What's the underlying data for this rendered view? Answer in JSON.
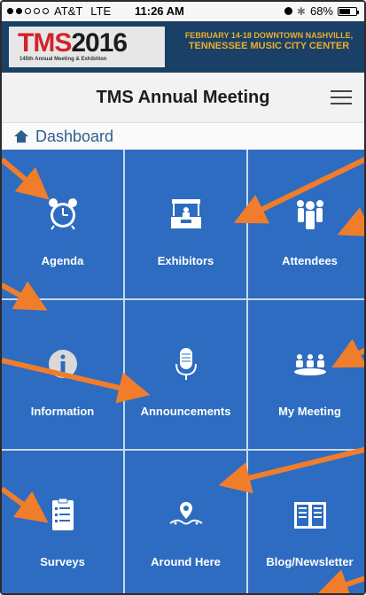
{
  "status_bar": {
    "carrier": "AT&T",
    "network": "LTE",
    "time": "11:26 AM",
    "battery": "68%",
    "battery_level": 0.68
  },
  "banner": {
    "logo_tms": "TMS",
    "logo_year": "2016",
    "logo_subtitle": "145th Annual Meeting & Exhibition",
    "dates_line": "FEBRUARY 14-18 DOWNTOWN NASHVILLE,",
    "venue_line": "TENNESSEE MUSIC CITY CENTER"
  },
  "header": {
    "title": "TMS Annual Meeting",
    "menu_icon": "hamburger-icon"
  },
  "breadcrumb": {
    "icon": "home-icon",
    "label": "Dashboard"
  },
  "tiles": [
    {
      "label": "Agenda",
      "icon": "alarm-clock-icon"
    },
    {
      "label": "Exhibitors",
      "icon": "booth-icon"
    },
    {
      "label": "Attendees",
      "icon": "people-icon"
    },
    {
      "label": "Information",
      "icon": "info-icon"
    },
    {
      "label": "Announcements",
      "icon": "microphone-icon"
    },
    {
      "label": "My Meeting",
      "icon": "meeting-table-icon"
    },
    {
      "label": "Surveys",
      "icon": "clipboard-icon"
    },
    {
      "label": "Around Here",
      "icon": "map-pin-icon"
    },
    {
      "label": "Blog/Newsletter",
      "icon": "open-book-icon"
    }
  ],
  "colors": {
    "tile": "#2d6cc0",
    "banner": "#1a4068",
    "arrow": "#f07d2b",
    "accent_red": "#d2232a",
    "banner_gold": "#e8b02e"
  }
}
